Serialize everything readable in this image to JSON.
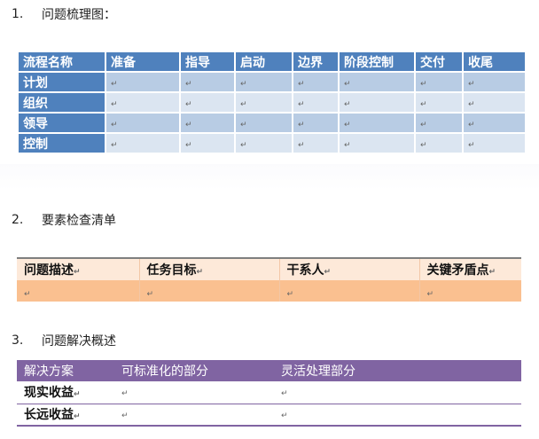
{
  "colors": {
    "blue_header": "#4f81bd",
    "blue_band_dark": "#b8cce4",
    "blue_band_light": "#dbe5f1",
    "orange_header": "#fde9d9",
    "orange_row": "#fac090",
    "purple_header": "#8064a2"
  },
  "para_mark": "↵",
  "sections": [
    {
      "number": "1.",
      "title": "问题梳理图：",
      "table": {
        "headers": [
          "流程名称",
          "准备",
          "指导",
          "启动",
          "边界",
          "阶段控制",
          "交付",
          "收尾"
        ],
        "rows": [
          {
            "label": "计划",
            "cells": [
              "↵",
              "↵",
              "↵",
              "↵",
              "↵",
              "↵",
              "↵"
            ]
          },
          {
            "label": "组织",
            "cells": [
              "↵",
              "↵",
              "↵",
              "↵",
              "↵",
              "↵",
              "↵"
            ]
          },
          {
            "label": "领导",
            "cells": [
              "↵",
              "↵",
              "↵",
              "↵",
              "↵",
              "↵",
              "↵"
            ]
          },
          {
            "label": "控制",
            "cells": [
              "↵",
              "↵",
              "↵",
              "↵",
              "↵",
              "↵",
              "↵"
            ]
          }
        ]
      }
    },
    {
      "number": "2.",
      "title": "要素检查清单",
      "table": {
        "headers": [
          "问题描述",
          "任务目标",
          "干系人",
          "关键矛盾点"
        ],
        "rows": [
          {
            "cells": [
              "↵",
              "↵",
              "↵",
              "↵"
            ]
          }
        ]
      }
    },
    {
      "number": "3.",
      "title": "问题解决概述",
      "table": {
        "headers": [
          "解决方案",
          "可标准化的部分",
          "灵活处理部分"
        ],
        "rows": [
          {
            "label": "现实收益",
            "cells": [
              "↵",
              "↵"
            ]
          },
          {
            "label": "长远收益",
            "cells": [
              "↵",
              "↵"
            ]
          }
        ]
      }
    }
  ]
}
